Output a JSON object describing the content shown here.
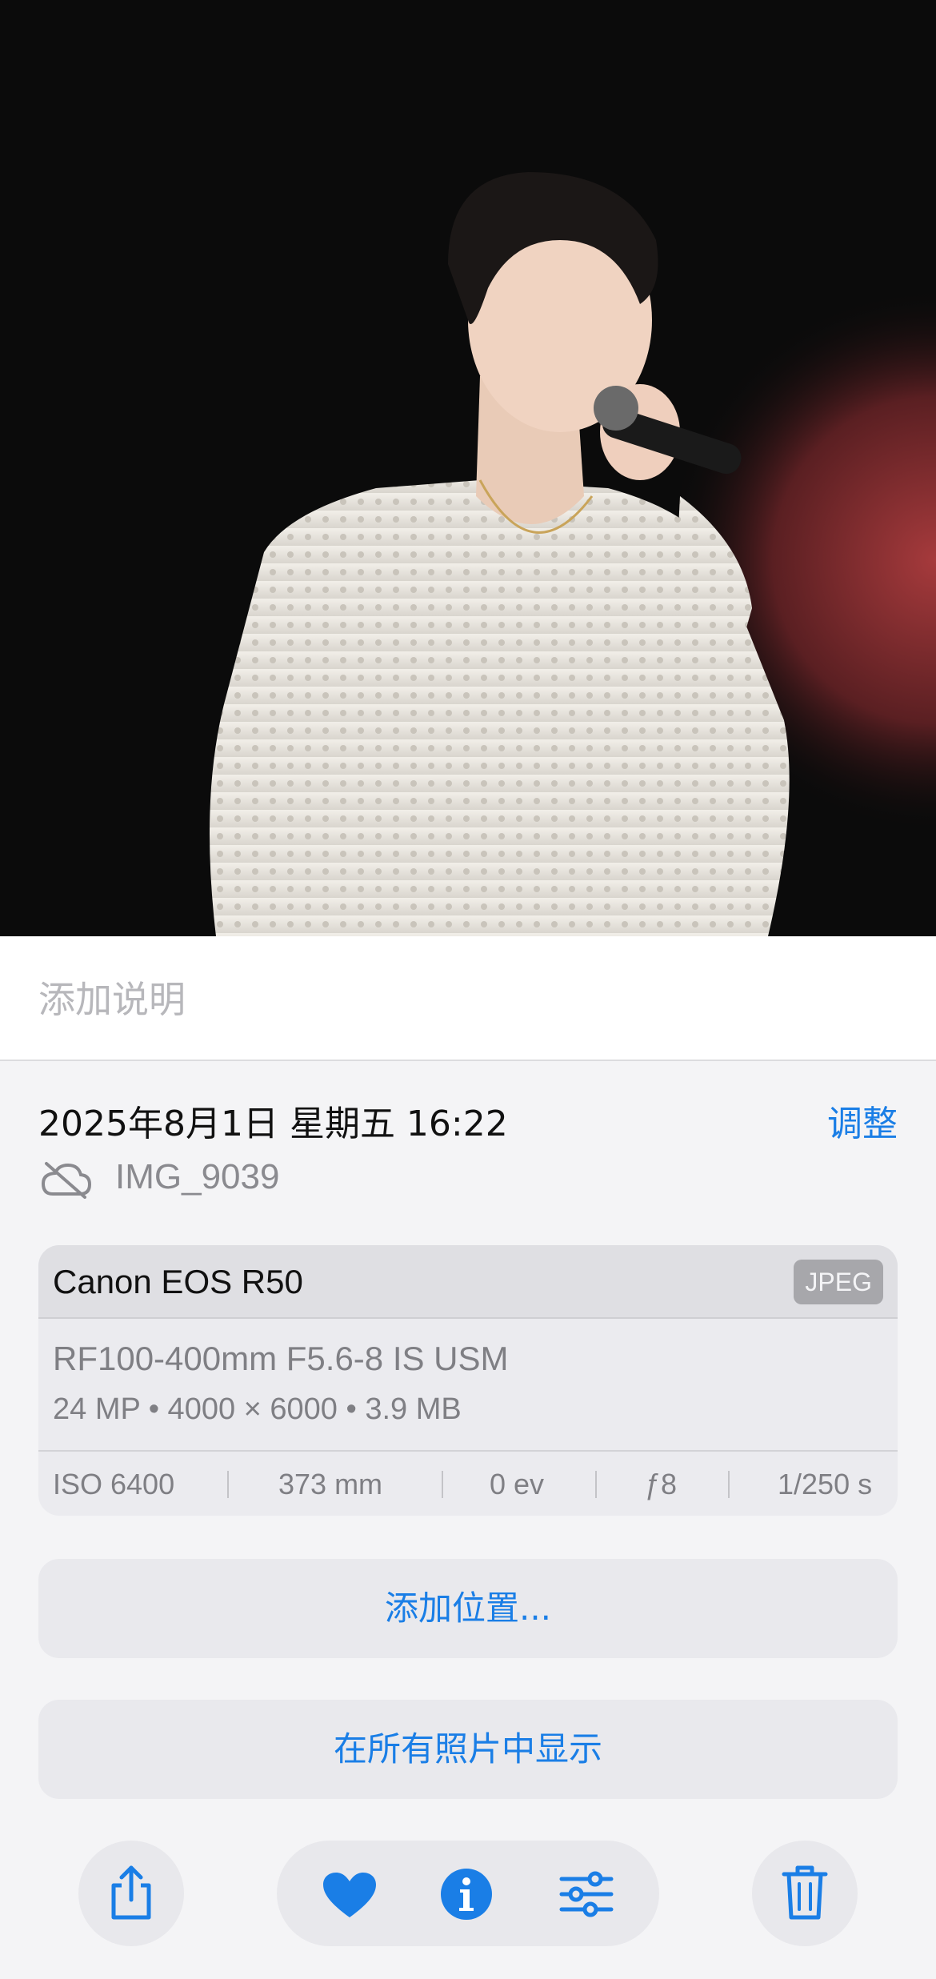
{
  "caption": {
    "placeholder": "添加说明"
  },
  "meta": {
    "datetime": "2025年8月1日 星期五 16:22",
    "adjust_label": "调整",
    "filename": "IMG_9039",
    "cloud_icon": "cloud-slash-icon"
  },
  "exif": {
    "camera": "Canon EOS R50",
    "format": "JPEG",
    "lens": "RF100-400mm F5.6-8 IS USM",
    "specs": "24 MP • 4000 × 6000 • 3.9 MB",
    "iso": "ISO 6400",
    "focal_length": "373 mm",
    "exposure_comp": "0 ev",
    "aperture": "ƒ8",
    "shutter": "1/250 s"
  },
  "actions": {
    "add_location": "添加位置...",
    "show_in_all_photos": "在所有照片中显示"
  },
  "toolbar": {
    "icons": [
      "share-icon",
      "heart-icon",
      "info-icon",
      "adjust-sliders-icon",
      "trash-icon"
    ],
    "accent": "#1a7ee6"
  },
  "colors": {
    "accent": "#1a7ee6",
    "background": "#f4f4f6"
  }
}
